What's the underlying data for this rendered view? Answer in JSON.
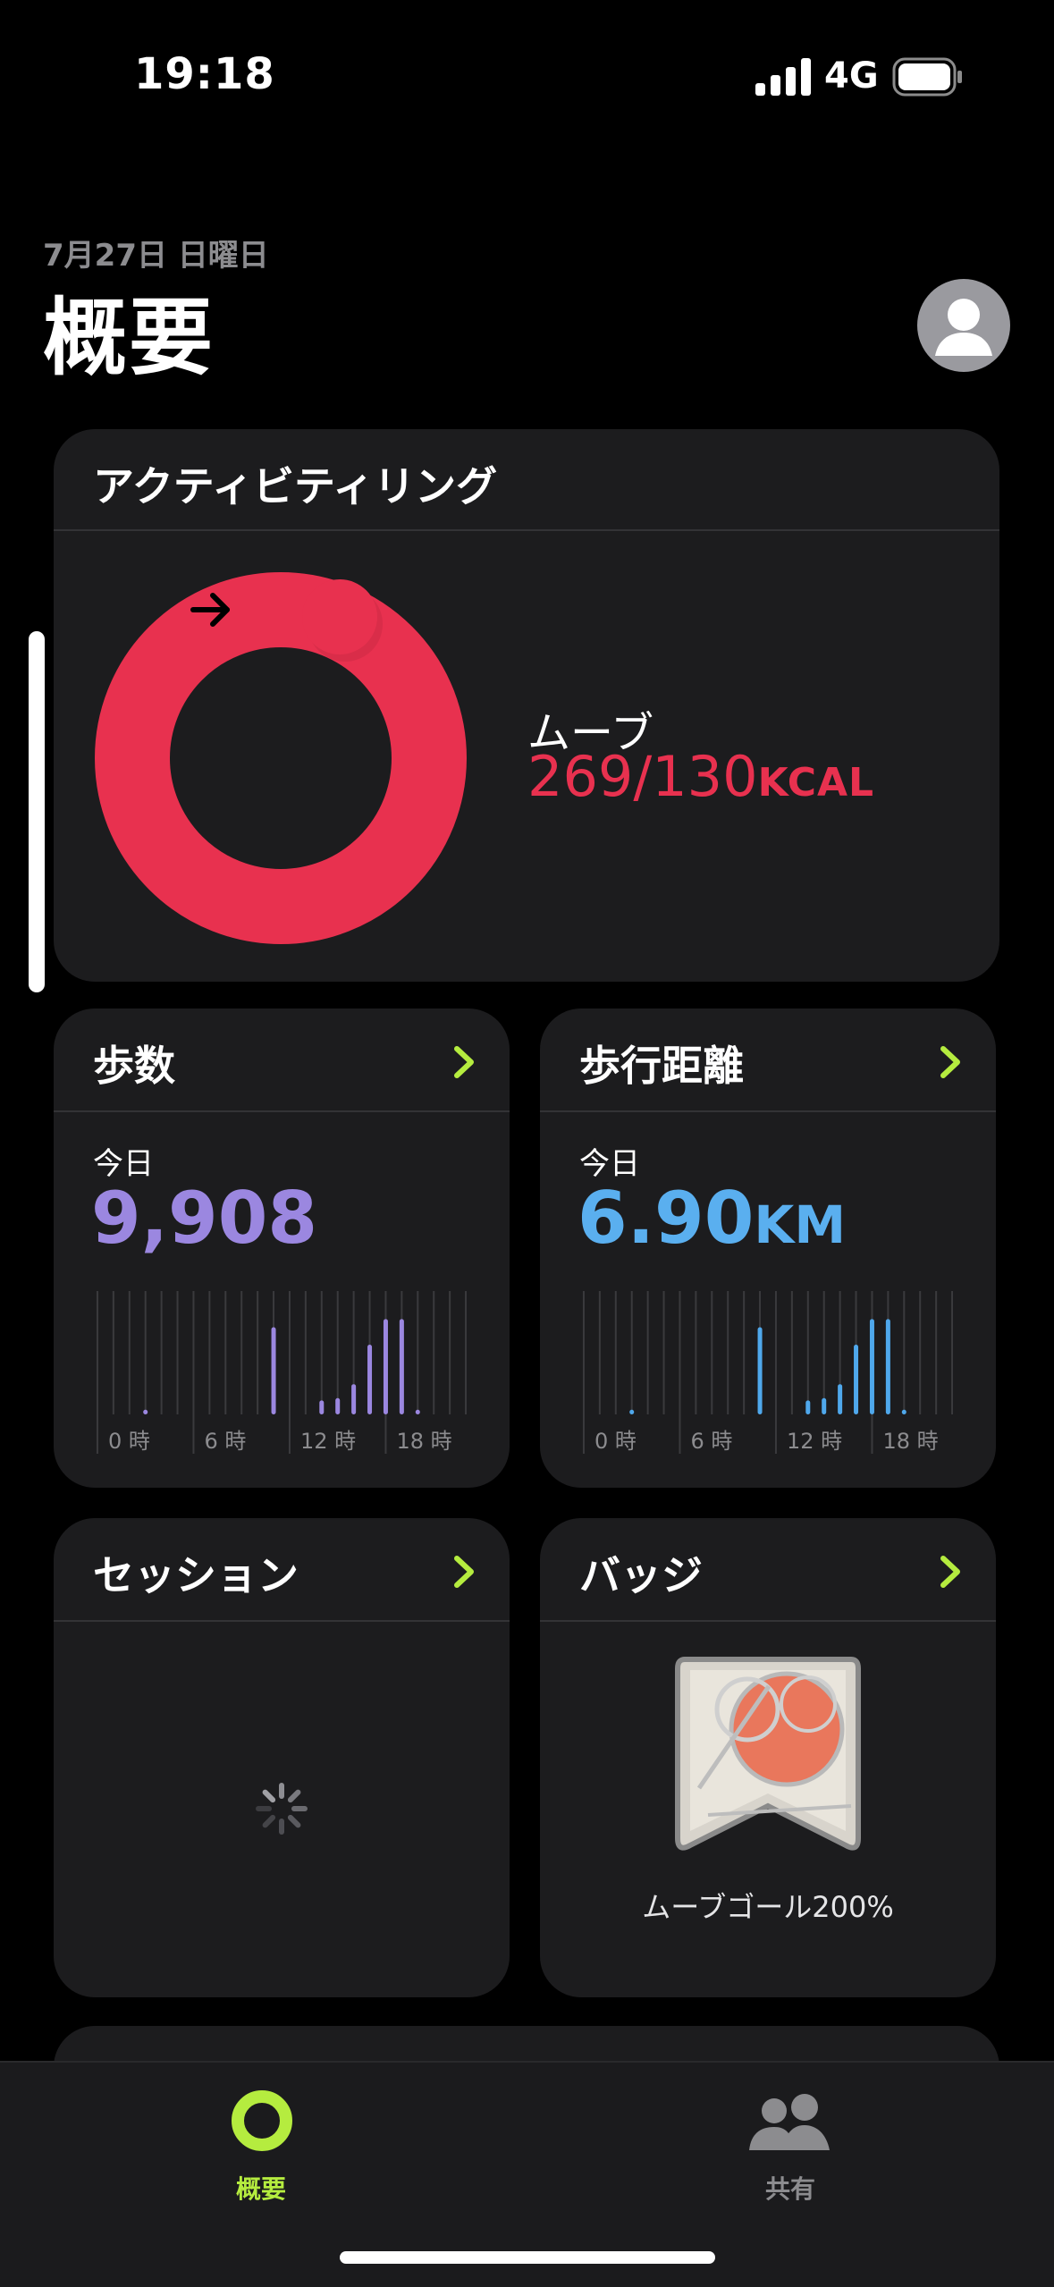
{
  "status_bar": {
    "time": "19:18",
    "network": "4G"
  },
  "header": {
    "date": "7月27日 日曜日",
    "title": "概要"
  },
  "activity_ring": {
    "title": "アクティビティリング",
    "move_label": "ムーブ",
    "move_value": "269/130",
    "move_unit": "KCAL",
    "move_progress": 2.07,
    "ring_color": "#e8314f"
  },
  "steps": {
    "title": "歩数",
    "today_label": "今日",
    "value": "9,908",
    "bar_color": "#9b87e0",
    "axis_labels": [
      "0 時",
      "6 時",
      "12 時",
      "18 時"
    ],
    "hourly": [
      0,
      0,
      0,
      0.04,
      0,
      0,
      0,
      0,
      0,
      0,
      0,
      0.75,
      0,
      0,
      0.12,
      0.14,
      0.26,
      0.6,
      0.82,
      0.82,
      0.04,
      0,
      0,
      0
    ]
  },
  "distance": {
    "title": "歩行距離",
    "today_label": "今日",
    "value": "6.90",
    "unit": "KM",
    "value_color": "#5aafef",
    "bar_color": "#4fa8ec",
    "axis_labels": [
      "0 時",
      "6 時",
      "12 時",
      "18 時"
    ],
    "hourly": [
      0,
      0,
      0,
      0.04,
      0,
      0,
      0,
      0,
      0,
      0,
      0,
      0.75,
      0,
      0,
      0.12,
      0.14,
      0.26,
      0.6,
      0.82,
      0.82,
      0.04,
      0,
      0,
      0
    ]
  },
  "sessions": {
    "title": "セッション"
  },
  "badges": {
    "title": "バッジ",
    "caption": "ムーブゴール200%"
  },
  "tabbar": {
    "tabs": [
      {
        "label": "概要",
        "icon": "activity-ring-icon",
        "active": true
      },
      {
        "label": "共有",
        "icon": "people-icon",
        "active": false
      }
    ],
    "active_color": "#b5ec3f",
    "inactive_color": "#8c8c8f"
  }
}
